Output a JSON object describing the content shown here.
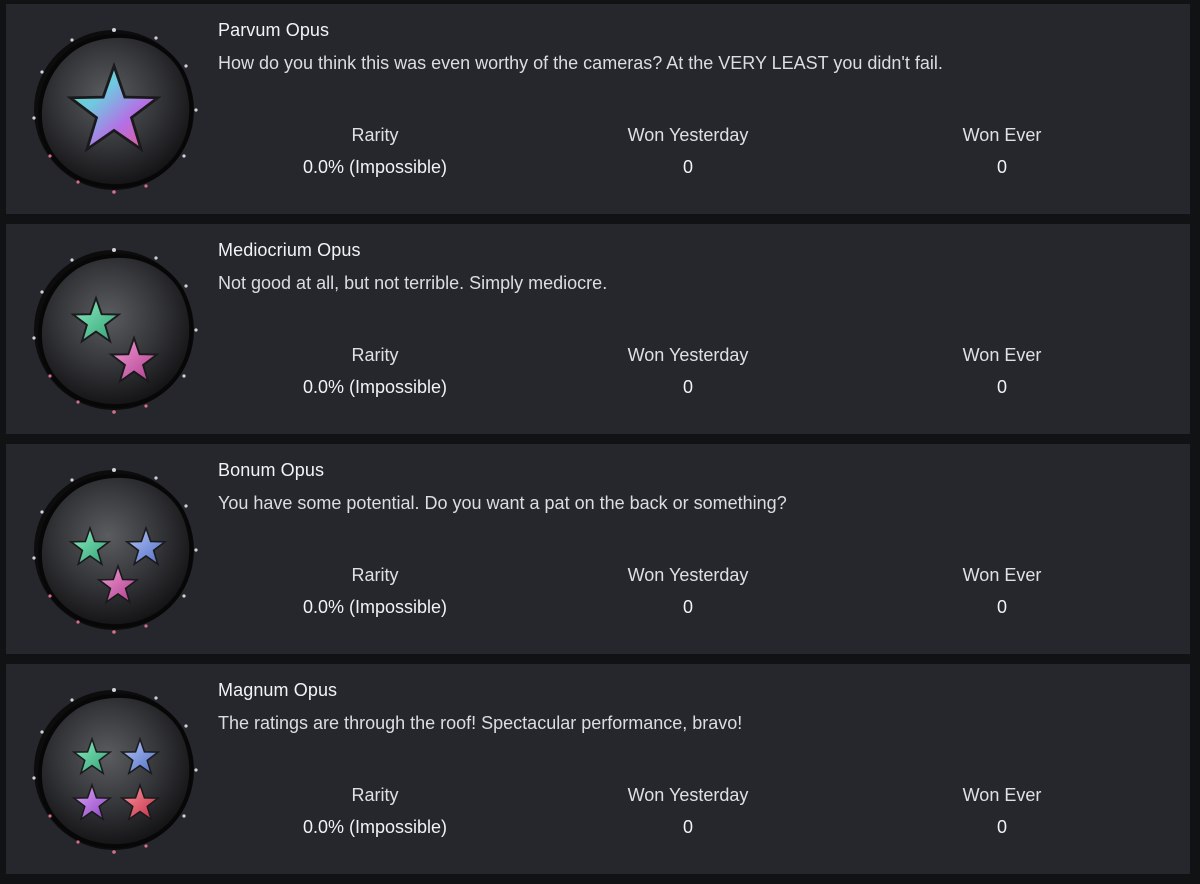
{
  "badges": [
    {
      "title": "Parvum Opus",
      "description": "How do you think this was even worthy of the cameras? At the VERY LEAST you didn't fail.",
      "icon": "one-star-badge-icon",
      "rarity_label": "Rarity",
      "rarity_value": "0.0% (Impossible)",
      "won_yesterday_label": "Won Yesterday",
      "won_yesterday_value": "0",
      "won_ever_label": "Won Ever",
      "won_ever_value": "0"
    },
    {
      "title": "Mediocrium Opus",
      "description": "Not good at all, but not terrible. Simply mediocre.",
      "icon": "two-star-badge-icon",
      "rarity_label": "Rarity",
      "rarity_value": "0.0% (Impossible)",
      "won_yesterday_label": "Won Yesterday",
      "won_yesterday_value": "0",
      "won_ever_label": "Won Ever",
      "won_ever_value": "0"
    },
    {
      "title": "Bonum Opus",
      "description": "You have some potential. Do you want a pat on the back or something?",
      "icon": "three-star-badge-icon",
      "rarity_label": "Rarity",
      "rarity_value": "0.0% (Impossible)",
      "won_yesterday_label": "Won Yesterday",
      "won_yesterday_value": "0",
      "won_ever_label": "Won Ever",
      "won_ever_value": "0"
    },
    {
      "title": "Magnum Opus",
      "description": "The ratings are through the roof! Spectacular performance, bravo!",
      "icon": "four-star-badge-icon",
      "rarity_label": "Rarity",
      "rarity_value": "0.0% (Impossible)",
      "won_yesterday_label": "Won Yesterday",
      "won_yesterday_value": "0",
      "won_ever_label": "Won Ever",
      "won_ever_value": "0"
    }
  ],
  "colors": {
    "page_background": "#111214",
    "card_background": "#26272c",
    "text": "#e9eaec",
    "star_green": "#4fd39a",
    "star_purple": "#b27ae6",
    "star_blue": "#7f9be8",
    "star_red": "#e0566f"
  }
}
